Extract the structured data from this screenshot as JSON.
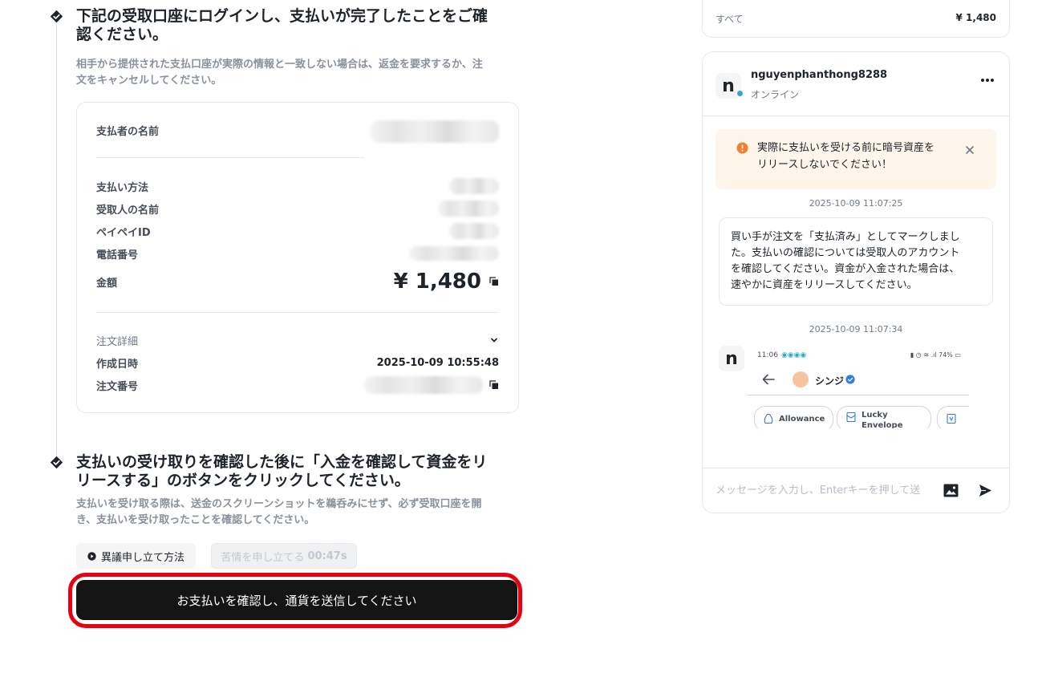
{
  "step1": {
    "title_line1": "下記の受取口座にログインし、支払いが完了したことをご確",
    "title_line2": "認ください。",
    "desc_line1": "相手から提供された支払口座が実際の情報と一致しない場合は、返金を要求するか、注",
    "desc_line2": "文をキャンセルしてください。"
  },
  "payment": {
    "payer_name_label": "支払者の名前",
    "method_label": "支払い方法",
    "recipient_label": "受取人の名前",
    "paypay_label": "ペイペイID",
    "phone_label": "電話番号",
    "amount_label": "金額",
    "amount_value": "¥ 1,480",
    "details_label": "注文詳細",
    "created_label": "作成日時",
    "created_value": "2025-10-09 10:55:48",
    "order_no_label": "注文番号"
  },
  "step2": {
    "title_line1": "支払いの受け取りを確認した後に「入金を確認して資金をリ",
    "title_line2": "リースする」のボタンをクリックしてください。",
    "desc_line1": "支払いを受け取る際は、送金のスクリーンショットを鵜呑みにせず、必ず受取口座を開",
    "desc_line2": "き、支払いを受け取ったことを確認してください。"
  },
  "buttons": {
    "appeal_how": "異議申し立て方法",
    "appeal": "苦情を申し立てる",
    "appeal_timer": "00:47s",
    "confirm": "お支払いを確認し、通貨を送信してください"
  },
  "summary": {
    "all_label": "すべて",
    "all_value": "¥ 1,480"
  },
  "chat": {
    "avatar_letter": "n",
    "username": "nguyenphanthong8288",
    "status": "オンライン",
    "warning_line1": "実際に支払いを受ける前に暗号資産を",
    "warning_line2": "リリースしないでください！",
    "msg1_time": "2025-10-09 11:07:25",
    "msg1_line1": "買い手が注文を「支払済み」としてマークしまし",
    "msg1_line2": "た。支払いの確認については受取人のアカウント",
    "msg1_line3": "を確認してください。資金が入金された場合は、",
    "msg1_line4": "速やかに資産をリリースしてください。",
    "msg2_time": "2025-10-09 11:07:34",
    "input_placeholder": "メッセージを入力し、Enterキーを押して送"
  },
  "screenshot": {
    "time": "11:06",
    "battery": "74%",
    "name": "シンジ",
    "chip1": "Allowance",
    "chip2": "Lucky Envelope"
  },
  "colors": {
    "highlight": "#e60012",
    "primary_button": "#141414",
    "warning_bg": "#fef6ea",
    "warning_icon": "#f0822f",
    "online": "#2ea9c9"
  }
}
